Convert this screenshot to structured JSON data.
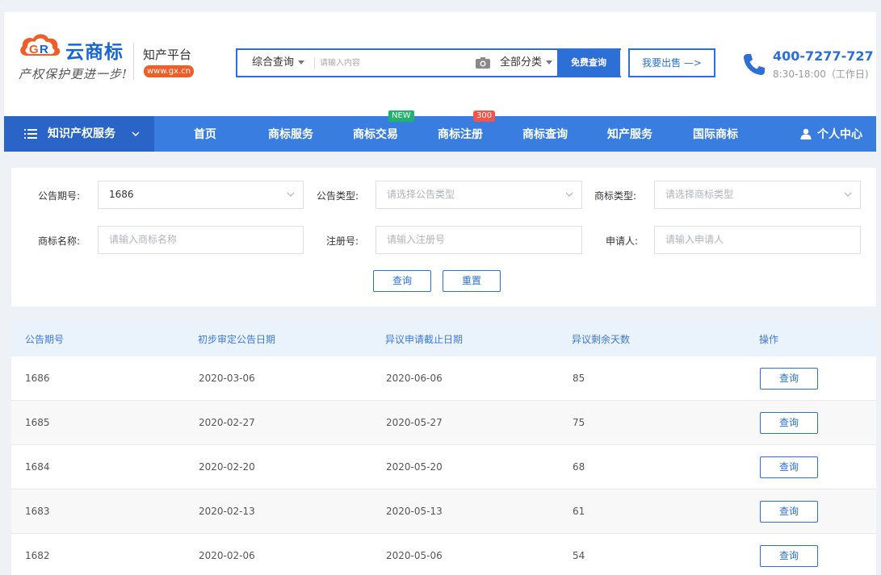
{
  "header": {
    "logo_text": "云商标",
    "slogan": "产权保护更进一步!",
    "brand_name": "知产平台",
    "brand_url": "www.gx.cn",
    "search": {
      "type_label": "综合查询",
      "placeholder": "请输入内容",
      "category_label": "全部分类",
      "submit_label": "免费查询"
    },
    "sell_label": "我要出售 —>",
    "phone": "400-7277-727",
    "hours": "8:30-18:00（工作日)"
  },
  "nav": {
    "category_label": "知识产权服务",
    "items": [
      {
        "label": "首页",
        "badge": ""
      },
      {
        "label": "商标服务",
        "badge": ""
      },
      {
        "label": "商标交易",
        "badge": "NEW"
      },
      {
        "label": "商标注册",
        "badge": "300"
      },
      {
        "label": "商标查询",
        "badge": ""
      },
      {
        "label": "知产服务",
        "badge": ""
      },
      {
        "label": "国际商标",
        "badge": ""
      }
    ],
    "user_center": "个人中心"
  },
  "filter": {
    "issue_no": {
      "label": "公告期号:",
      "value": "1686"
    },
    "notice_type": {
      "label": "公告类型:",
      "placeholder": "请选择公告类型"
    },
    "mark_type": {
      "label": "商标类型:",
      "placeholder": "请选择商标类型"
    },
    "mark_name": {
      "label": "商标名称:",
      "placeholder": "请输入商标名称"
    },
    "reg_no": {
      "label": "注册号:",
      "placeholder": "请输入注册号"
    },
    "applicant": {
      "label": "申请人:",
      "placeholder": "请输入申请人"
    },
    "query_label": "查询",
    "reset_label": "重置"
  },
  "table": {
    "headers": [
      "公告期号",
      "初步审定公告日期",
      "异议申请截止日期",
      "异议剩余天数",
      "操作"
    ],
    "action_label": "查询",
    "rows": [
      [
        "1686",
        "2020-03-06",
        "2020-06-06",
        "85"
      ],
      [
        "1685",
        "2020-02-27",
        "2020-05-27",
        "75"
      ],
      [
        "1684",
        "2020-02-20",
        "2020-05-20",
        "68"
      ],
      [
        "1683",
        "2020-02-13",
        "2020-05-13",
        "61"
      ],
      [
        "1682",
        "2020-02-06",
        "2020-05-06",
        "54"
      ]
    ]
  },
  "colors": {
    "primary": "#2c6fd7",
    "nav": "#3a7de0",
    "nav_dark": "#2a64c6",
    "logo_orange": "#ef5e27",
    "badge_new": "#21b36b",
    "badge_hot": "#f2554a"
  }
}
